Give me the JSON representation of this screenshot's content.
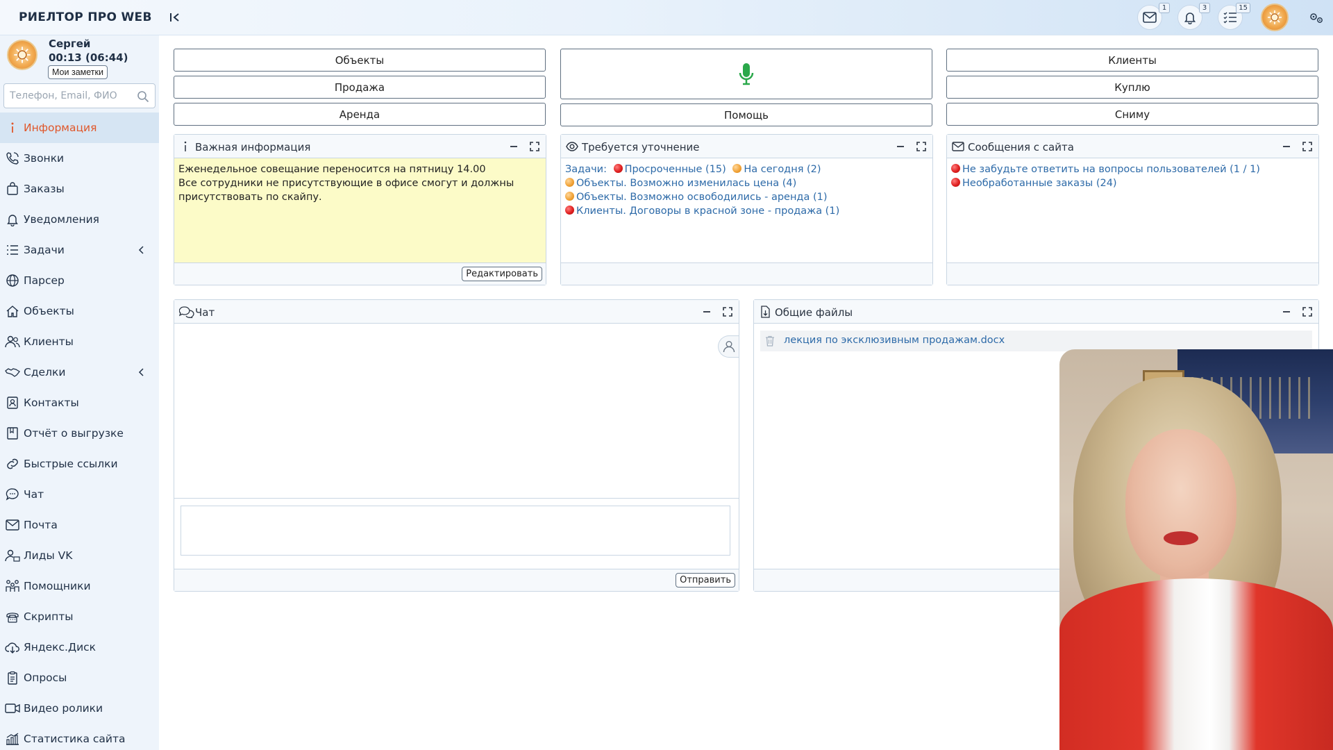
{
  "app": {
    "title": "РИЕЛТОР ПРО WEB"
  },
  "top": {
    "mail_badge": "1",
    "bell_badge": "3",
    "tasks_badge": "15"
  },
  "user": {
    "name": "Сергей",
    "time": "00:13 (06:44)",
    "notes_label": "Мои заметки"
  },
  "search": {
    "placeholder": "Телефон, Email, ФИО"
  },
  "nav": {
    "items": [
      {
        "label": "Информация",
        "icon": "info-icon",
        "active": true
      },
      {
        "label": "Звонки",
        "icon": "phone-icon"
      },
      {
        "label": "Заказы",
        "icon": "bag-icon"
      },
      {
        "label": "Уведомления",
        "icon": "bell-icon"
      },
      {
        "label": "Задачи",
        "icon": "tasks-icon",
        "expandable": true
      },
      {
        "label": "Парсер",
        "icon": "globe-icon"
      },
      {
        "label": "Объекты",
        "icon": "home-icon"
      },
      {
        "label": "Клиенты",
        "icon": "users-icon"
      },
      {
        "label": "Сделки",
        "icon": "handshake-icon",
        "expandable": true
      },
      {
        "label": "Контакты",
        "icon": "contact-card-icon"
      },
      {
        "label": "Отчёт о выгрузке",
        "icon": "report-icon"
      },
      {
        "label": "Быстрые ссылки",
        "icon": "link-icon"
      },
      {
        "label": "Чат",
        "icon": "chat-icon"
      },
      {
        "label": "Почта",
        "icon": "mail-icon"
      },
      {
        "label": "Лиды VK",
        "icon": "leads-icon"
      },
      {
        "label": "Помощники",
        "icon": "helpers-icon"
      },
      {
        "label": "Скрипты",
        "icon": "script-icon"
      },
      {
        "label": "Яндекс.Диск",
        "icon": "cloud-download-icon"
      },
      {
        "label": "Опросы",
        "icon": "clipboard-icon"
      },
      {
        "label": "Видео ролики",
        "icon": "video-icon"
      },
      {
        "label": "Статистика сайта",
        "icon": "chart-icon"
      }
    ]
  },
  "buttons": {
    "objects": "Объекты",
    "sale": "Продажа",
    "rent": "Аренда",
    "help": "Помощь",
    "clients": "Клиенты",
    "buy": "Куплю",
    "rent_take": "Сниму"
  },
  "panels": {
    "important": {
      "title": "Важная информация",
      "lines": [
        "Еженедельное совещание переносится на пятницу 14.00",
        "Все сотрудники не присутствующие в офисе смогут и должны присутствовать по скайпу."
      ],
      "edit_label": "Редактировать"
    },
    "clarify": {
      "title": "Требуется уточнение",
      "tasks_label": "Задачи:",
      "overdue": "Просроченные (15)",
      "today": "На сегодня (2)",
      "items": [
        "Объекты. Возможно изменилась цена (4)",
        "Объекты. Возможно освободились - аренда (1)",
        "Клиенты. Договоры в красной зоне - продажа (1)"
      ]
    },
    "site_messages": {
      "title": "Сообщения с сайта",
      "items": [
        "Не забудьте ответить на вопросы пользователей (1 / 1)",
        "Необработанные заказы (24)"
      ]
    },
    "chat": {
      "title": "Чат",
      "send_label": "Отправить"
    },
    "files": {
      "title": "Общие файлы",
      "items": [
        "лекция по эксклюзивным продажам.docx"
      ]
    }
  },
  "colors": {
    "accent_active": "#e0572a",
    "link": "#2d6aa8",
    "info_bg": "#fcfbc8",
    "mic": "#2aa84a"
  }
}
